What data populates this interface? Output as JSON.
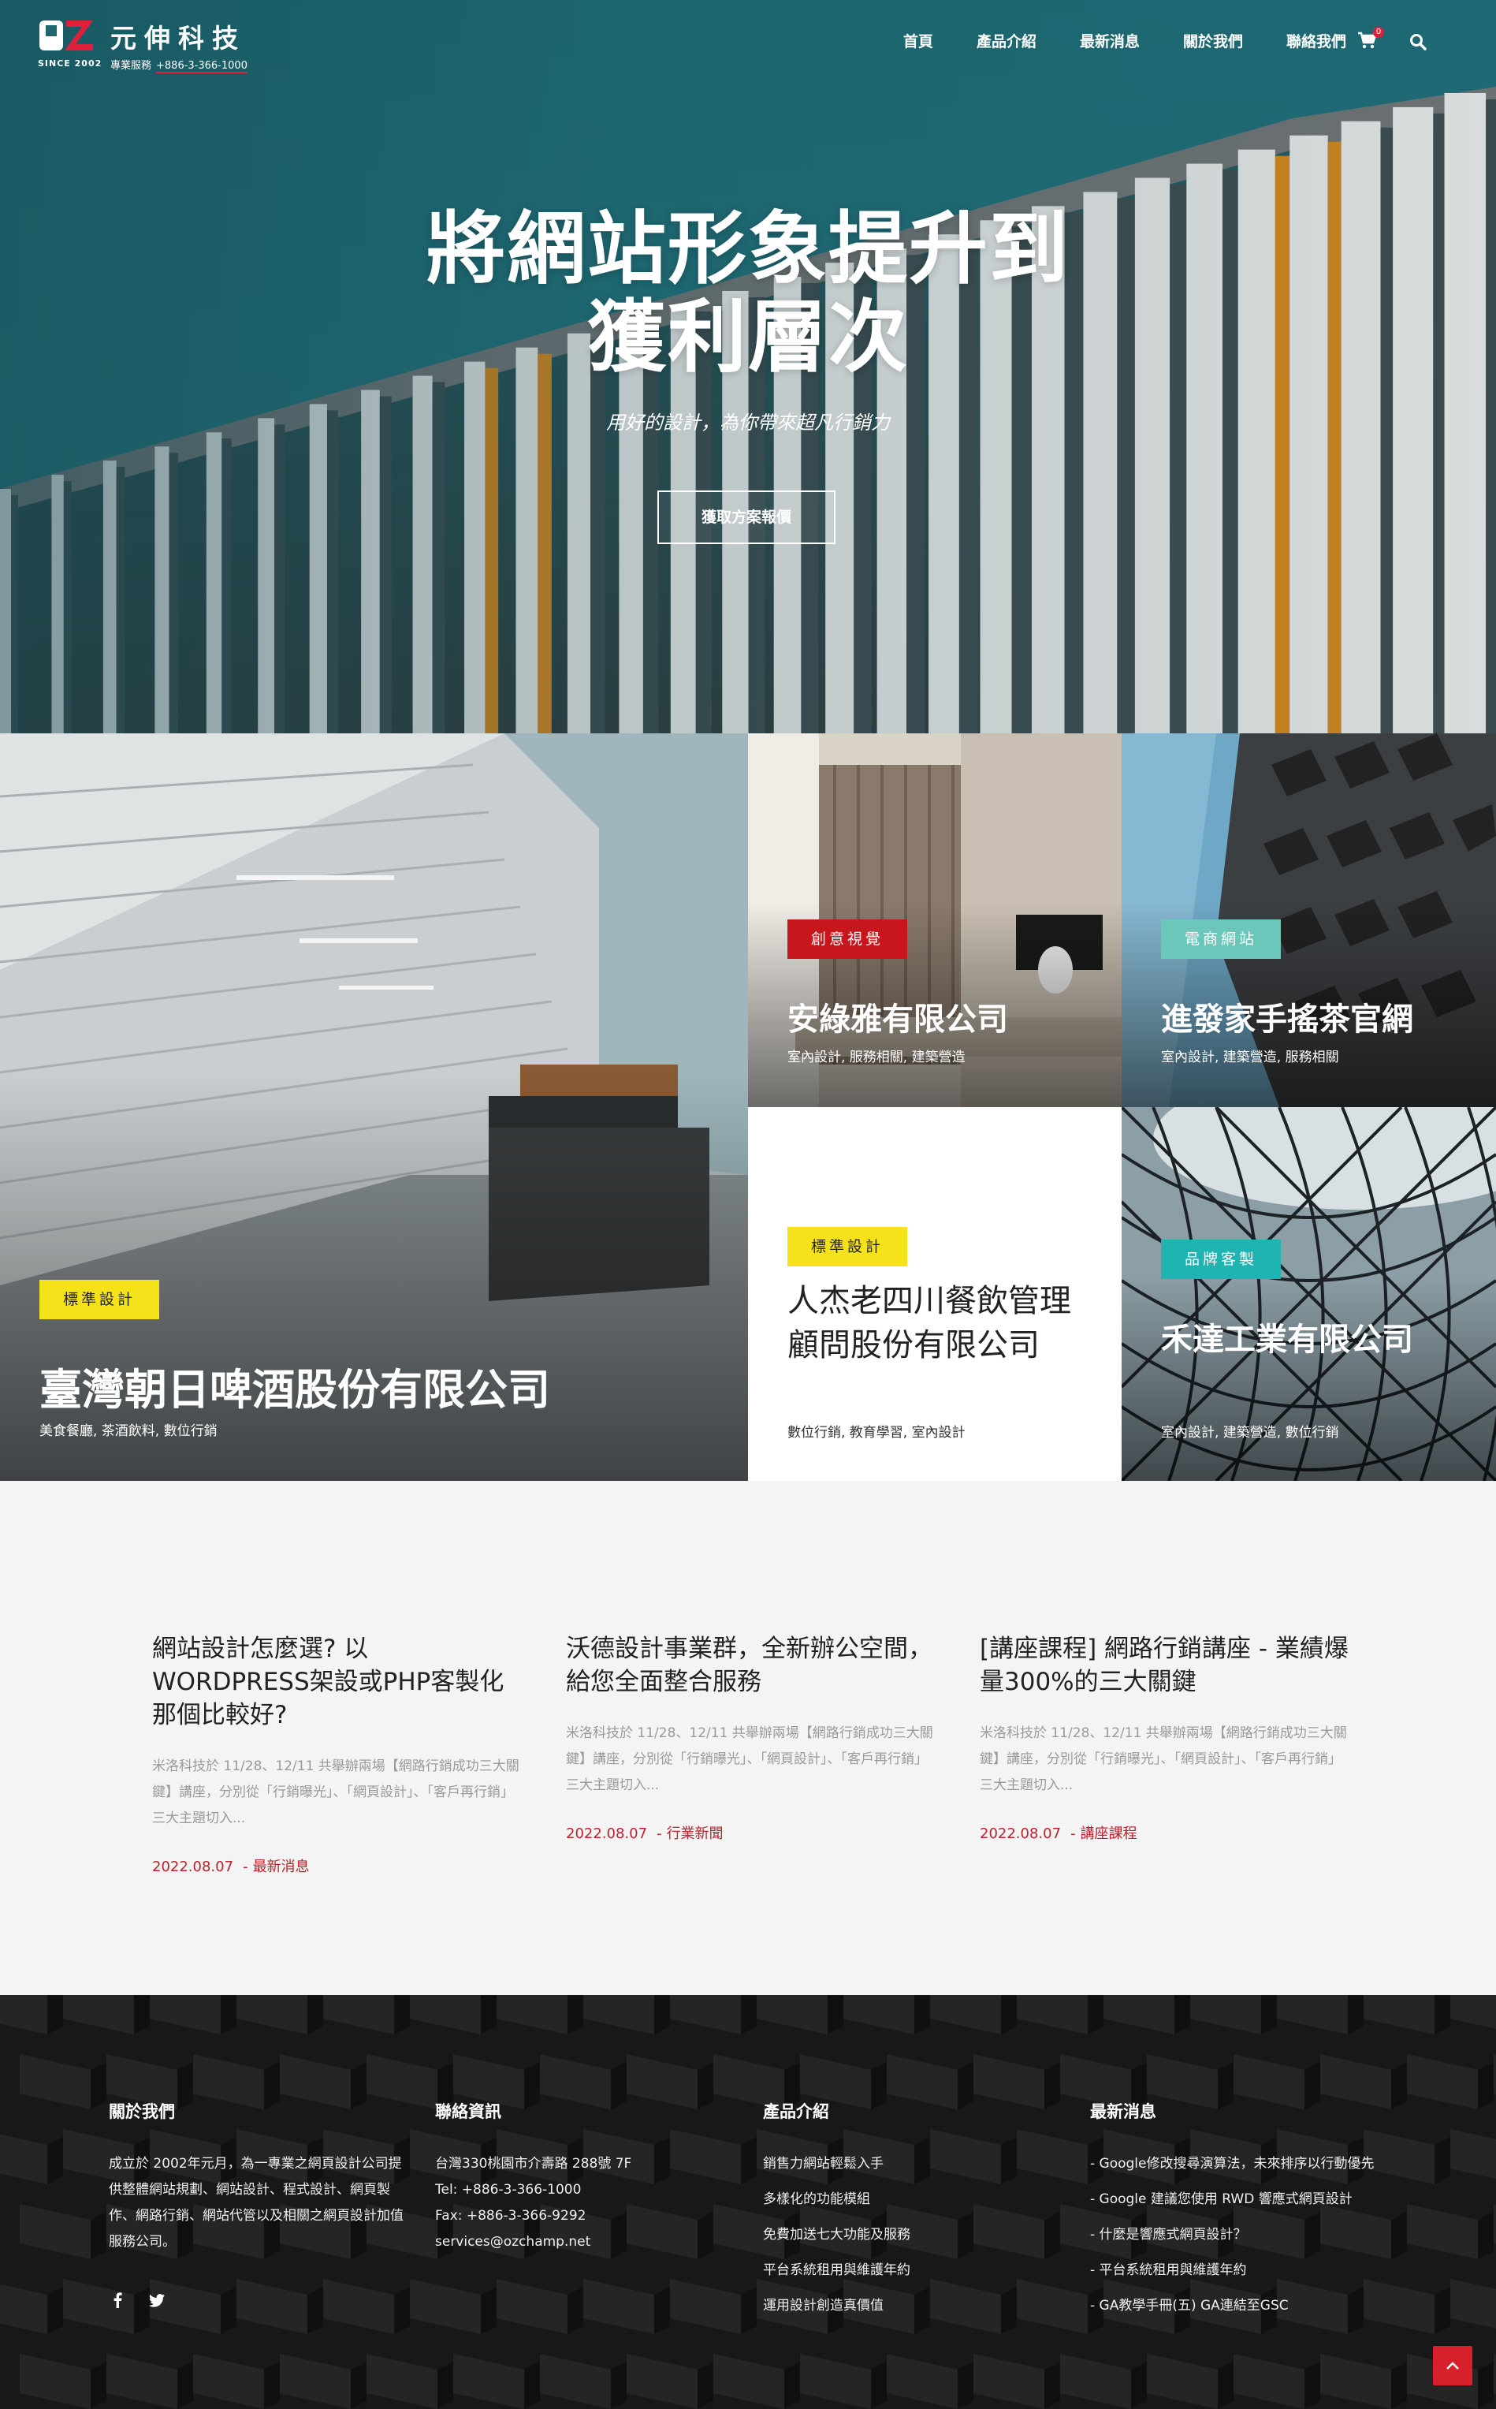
{
  "brand": {
    "since": "SINCE 2002",
    "name": "元伸科技",
    "tagline": "專業服務",
    "phone": "+886-3-366-1000",
    "accent": "#e0203a"
  },
  "nav": {
    "items": [
      "首頁",
      "產品介紹",
      "最新消息",
      "關於我們",
      "聯絡我們"
    ],
    "cart_count": "0"
  },
  "hero": {
    "title_line1": "將網站形象提升到",
    "title_line2": "獲利層次",
    "subtitle": "用好的設計，為你帶來超凡行銷力",
    "cta": "獲取方案報價"
  },
  "portfolio": [
    {
      "tag": "標準設計",
      "tag_bg": "#f5e21a",
      "tag_fg": "#222",
      "title": "臺灣朝日啤酒股份有限公司",
      "cats": "美食餐廳, 茶酒飲料, 數位行銷"
    },
    {
      "tag": "創意視覺",
      "tag_bg": "#c8161d",
      "tag_fg": "#fff",
      "title": "安綠雅有限公司",
      "cats": "室內設計, 服務相關, 建築營造"
    },
    {
      "tag": "電商網站",
      "tag_bg": "#6ac7b9",
      "tag_fg": "#fff",
      "title": "進發家手搖茶官網",
      "cats": "室內設計, 建築營造, 服務相關"
    },
    {
      "tag": "標準設計",
      "tag_bg": "#f5e21a",
      "tag_fg": "#222",
      "title": "人杰老四川餐飲管理顧問股份有限公司",
      "cats": "數位行銷, 教育學習, 室內設計"
    },
    {
      "tag": "品牌客製",
      "tag_bg": "#1fb3b1",
      "tag_fg": "#fff",
      "title": "禾達工業有限公司",
      "cats": "室內設計, 建築營造, 數位行銷"
    }
  ],
  "news": [
    {
      "title": "網站設計怎麼選? 以WORDPRESS架設或PHP客製化那個比較好?",
      "excerpt": "米洛科技於 11/28、12/11 共舉辦兩場【網路行銷成功三大關鍵】講座，分別從「行銷曝光」、「網頁設計」、「客戶再行銷」三大主題切入...",
      "date": "2022.08.07",
      "category": "最新消息"
    },
    {
      "title": "沃德設計事業群，全新辦公空間，給您全面整合服務",
      "excerpt": "米洛科技於 11/28、12/11 共舉辦兩場【網路行銷成功三大關鍵】講座，分別從「行銷曝光」、「網頁設計」、「客戶再行銷」三大主題切入...",
      "date": "2022.08.07",
      "category": "行業新聞"
    },
    {
      "title": "[講座課程] 網路行銷講座 - 業績爆量300%的三大關鍵",
      "excerpt": "米洛科技於 11/28、12/11 共舉辦兩場【網路行銷成功三大關鍵】講座，分別從「行銷曝光」、「網頁設計」、「客戶再行銷」三大主題切入...",
      "date": "2022.08.07",
      "category": "講座課程"
    }
  ],
  "footer": {
    "about": {
      "heading": "關於我們",
      "text": "成立於 2002年元月，為一專業之網頁設計公司提供整體網站規劃、網站設計、程式設計、網頁製作、網路行銷、網站代管以及相關之網頁設計加值服務公司。"
    },
    "contact": {
      "heading": "聯絡資訊",
      "address": "台灣330桃園市介壽路 288號 7F",
      "tel": "Tel: +886-3-366-1000",
      "fax": "Fax: +886-3-366-9292",
      "email": "services@ozchamp.net"
    },
    "products": {
      "heading": "產品介紹",
      "items": [
        "銷售力網站輕鬆入手",
        "多樣化的功能模組",
        "免費加送七大功能及服務",
        "平台系統租用與維護年約",
        "運用設計創造真價值"
      ]
    },
    "latest": {
      "heading": "最新消息",
      "items": [
        "- Google修改搜尋演算法，未來排序以行動優先",
        "- Google 建議您使用 RWD 響應式網頁設計",
        "- 什麼是響應式網頁設計？",
        "- 平台系統租用與維護年約",
        "- GA教學手冊(五) GA連結至GSC"
      ]
    }
  }
}
